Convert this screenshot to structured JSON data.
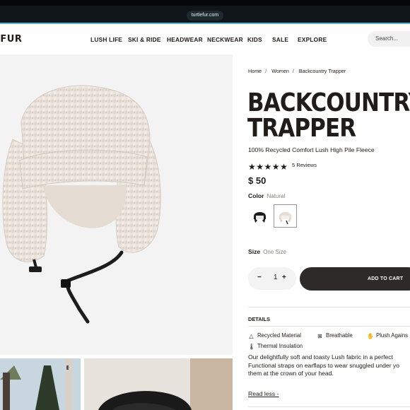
{
  "browser": {
    "url": "turtlefur.com"
  },
  "header": {
    "brand": "E FUR",
    "nav": [
      "LUSH LIFE",
      "SKI & RIDE",
      "HEADWEAR",
      "NECKWEAR",
      "KIDS",
      "SALE",
      "EXPLORE"
    ],
    "search_placeholder": "Search..."
  },
  "breadcrumb": [
    "Home",
    "Women",
    "Backcountry Trapper"
  ],
  "product": {
    "title_line1": "BACKCOUNTRY",
    "title_line2": "TRAPPER",
    "subtitle": "100% Recycled Comfort Lush High Pile Fleece",
    "rating": 5,
    "reviews": "5 Reviews",
    "price": "$ 50",
    "color_label": "Color",
    "color_value": "Natural",
    "swatches": [
      "black",
      "natural"
    ],
    "size_label": "Size",
    "size_value": "One Size",
    "quantity": "1",
    "minus": "−",
    "plus": "+",
    "add_to_cart": "ADD TO CART"
  },
  "details": {
    "heading": "DETAILS",
    "features": [
      "Recycled Material",
      "Breathable",
      "Plush Agains",
      "Thermal Insulation"
    ],
    "description": [
      "Our delightfully soft and toasty Lush fabric in a perfect",
      "Functional straps on earflaps to wear snuggled under yo",
      "them at the crown of your head."
    ],
    "read_less": "Read less -"
  },
  "colors": {
    "accent": "#2e2a27",
    "chrome": "#0f1518",
    "image_bg": "#f3f3f3"
  }
}
